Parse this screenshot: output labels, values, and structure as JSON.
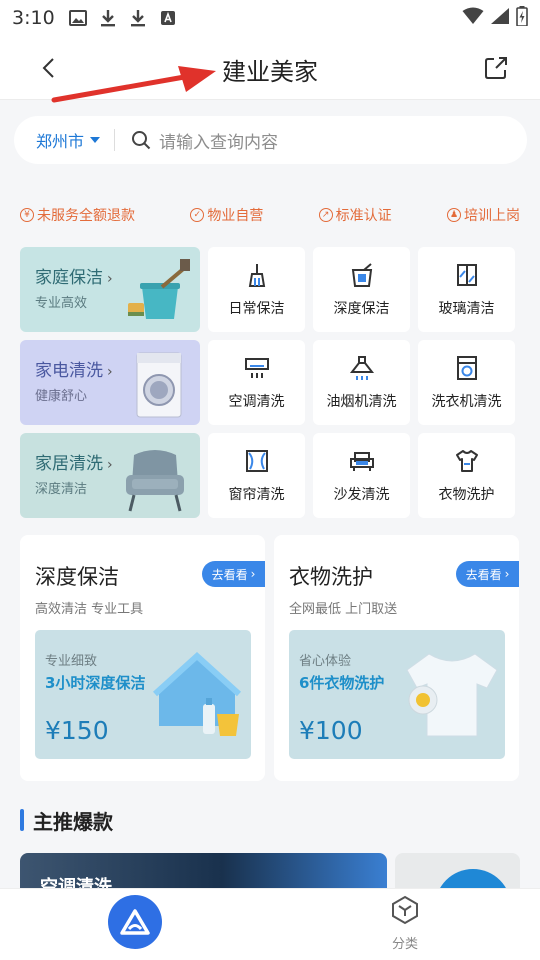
{
  "status": {
    "time": "3:10"
  },
  "nav": {
    "title": "建业美家"
  },
  "search": {
    "city": "郑州市",
    "placeholder": "请输入查询内容"
  },
  "promises": [
    "未服务全额退款",
    "物业自营",
    "标准认证",
    "培训上岗"
  ],
  "categories": [
    {
      "title": "家庭保洁",
      "subtitle": "专业高效",
      "bg": "#c6e4e4",
      "items": [
        {
          "label": "日常保洁",
          "icon": "broom-icon"
        },
        {
          "label": "深度保洁",
          "icon": "bucket-icon"
        },
        {
          "label": "玻璃清洁",
          "icon": "window-glass-icon"
        }
      ]
    },
    {
      "title": "家电清洗",
      "subtitle": "健康舒心",
      "bg": "#cfd3f3",
      "items": [
        {
          "label": "空调清洗",
          "icon": "air-conditioner-icon"
        },
        {
          "label": "油烟机清洗",
          "icon": "range-hood-icon"
        },
        {
          "label": "洗衣机清洗",
          "icon": "washing-machine-icon"
        }
      ]
    },
    {
      "title": "家居清洗",
      "subtitle": "深度清洁",
      "bg": "#c7e1df",
      "items": [
        {
          "label": "窗帘清洗",
          "icon": "curtain-icon"
        },
        {
          "label": "沙发清洗",
          "icon": "sofa-icon"
        },
        {
          "label": "衣物洗护",
          "icon": "shirt-icon"
        }
      ]
    }
  ],
  "promos": [
    {
      "title": "深度保洁",
      "subtitle": "高效清洁 专业工具",
      "go": "去看看",
      "kicker": "专业细致",
      "headline": "3小时深度保洁",
      "price": "¥150"
    },
    {
      "title": "衣物洗护",
      "subtitle": "全网最低 上门取送",
      "go": "去看看",
      "kicker": "省心体验",
      "headline": "6件衣物洗护",
      "price": "¥100"
    }
  ],
  "section": {
    "title": "主推爆款",
    "feature_label": "空调清洗"
  },
  "tabbar": {
    "category_label": "分类"
  },
  "colors": {
    "accent": "#2e6fe4",
    "promise": "#e36b3a",
    "link": "#1e78d6"
  }
}
